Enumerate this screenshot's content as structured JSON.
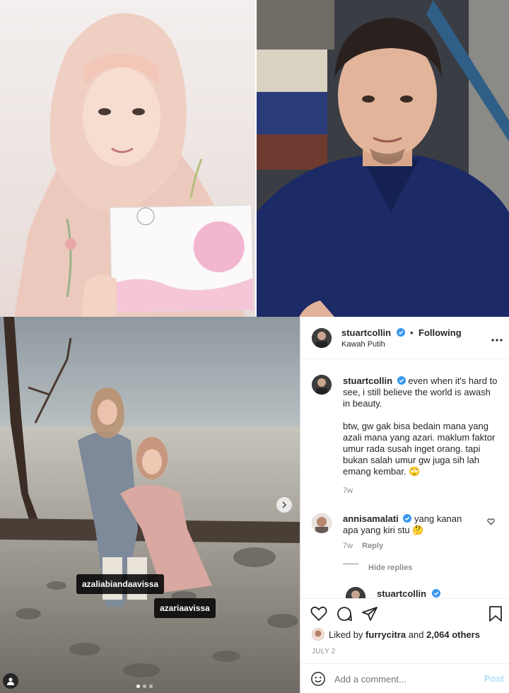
{
  "post": {
    "tags": [
      "azaliabiandaavissa",
      "azariaavissa"
    ],
    "carousel_dots": 3,
    "active_dot": 0
  },
  "header": {
    "username": "stuartcollin",
    "separator": "•",
    "follow_label": "Following",
    "location": "Kawah Putih",
    "more_icon": "more-horizontal-icon"
  },
  "caption": {
    "username": "stuartcollin",
    "text1": "even when it's hard to see, i still believe the world is awash in beauty.",
    "text2": "btw, gw gak bisa bedain mana yang azali mana yang azari. maklum faktor umur rada susah inget orang. tapi bukan salah umur gw juga sih lah emang kembar. 🙄",
    "time": "7w"
  },
  "comments": [
    {
      "username": "annisamalati",
      "text": "yang kanan apa yang kiri stu 🤔",
      "time": "7w",
      "reply_label": "Reply"
    }
  ],
  "hide_replies": "Hide replies",
  "reply_preview_user": "stuartcollin",
  "likes": {
    "prefix": "Liked by",
    "user": "furrycitra",
    "joiner": "and",
    "count": "2,064 others"
  },
  "date": "JULY 2",
  "add_comment": {
    "placeholder": "Add a comment...",
    "post_label": "Post"
  },
  "colors": {
    "verified": "#3897f0",
    "post_link": "#b2dffc",
    "muted": "#8e8e8e"
  }
}
